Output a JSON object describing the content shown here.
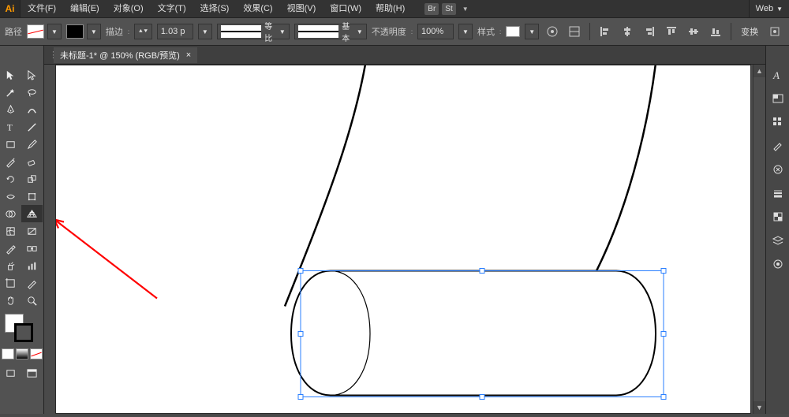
{
  "app": {
    "logo": "Ai",
    "workspace_label": "Web",
    "br_badge": "Br",
    "st_badge": "St"
  },
  "menu": {
    "file": "文件(F)",
    "edit": "编辑(E)",
    "object": "对象(O)",
    "type": "文字(T)",
    "select": "选择(S)",
    "effect": "效果(C)",
    "view": "视图(V)",
    "window": "窗口(W)",
    "help": "帮助(H)"
  },
  "control": {
    "mode_label": "路径",
    "stroke_label": "描边",
    "stroke_val": "1.03 p",
    "profile_label": "等比",
    "brushdef_label": "基本",
    "opacity_label": "不透明度",
    "opacity_val": "100%",
    "style_label": "样式",
    "transform_label": "变换"
  },
  "document": {
    "tab_title": "未标题-1* @ 150% (RGB/预览)",
    "close_glyph": "×"
  },
  "panels": [
    "character",
    "color",
    "swatches",
    "brushes",
    "symbols",
    "stroke",
    "layers",
    "appearance"
  ]
}
